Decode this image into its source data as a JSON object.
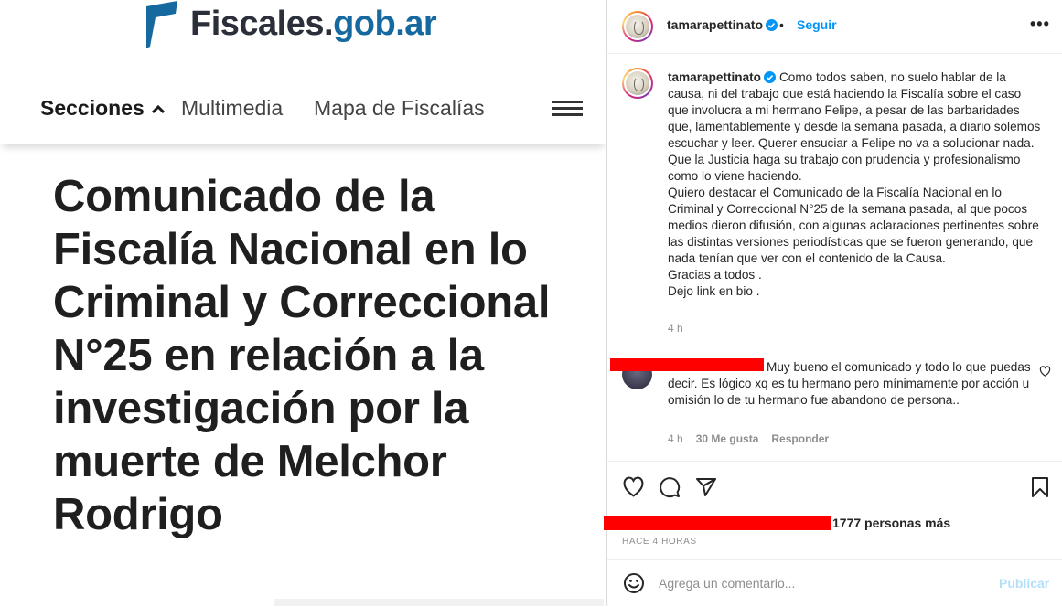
{
  "site": {
    "brand_part1": "Fiscales.",
    "brand_part2": "gob.ar",
    "nav": {
      "sections": "Secciones",
      "multimedia": "Multimedia",
      "mapa": "Mapa de Fiscalías"
    },
    "headline": "Comunicado de la Fiscalía Nacional en lo Criminal y Correccional N°25 en relación a la investigación por la muerte de Melchor Rodrigo"
  },
  "instagram": {
    "username": "tamarapettinato",
    "separator": "•",
    "follow_label": "Seguir",
    "more_label": "•••",
    "caption_text": "Como todos saben, no suelo hablar de la causa, ni del trabajo que está haciendo la Fiscalía sobre el caso que involucra a mi hermano Felipe, a pesar de las barbaridades que, lamentablemente y desde la semana pasada, a diario solemos escuchar y leer. Querer ensuciar a Felipe no va a solucionar nada. Que la Justicia haga su trabajo con prudencia y profesionalismo como lo viene haciendo.\nQuiero destacar el Comunicado de la Fiscalía Nacional en lo Criminal y Correccional N°25 de la semana pasada, al que pocos medios dieron difusión, con algunas aclaraciones pertinentes sobre las distintas versiones periodísticas que se fueron generando, que nada tenían que ver con el contenido de la Causa.\nGracias a todos .\nDejo link en bio .",
    "caption_time": "4 h",
    "comment": {
      "text": "Muy bueno el comunicado y todo lo que puedas decir. Es lógico xq es tu hermano pero mínimamente por acción u omisión lo de tu hermano fue abandono de persona..",
      "time": "4 h",
      "likes": "30 Me gusta",
      "reply": "Responder"
    },
    "likes_text": "1777 personas más",
    "time_ago": "HACE 4 HORAS",
    "comment_placeholder": "Agrega un comentario...",
    "post_label": "Publicar"
  },
  "colors": {
    "brand_dark": "#2a2f3a",
    "brand_blue": "#16699f",
    "ig_blue": "#0095f6",
    "redaction": "#ff0000"
  },
  "icons": [
    "fiscales-logo-icon",
    "chevron-up-icon",
    "hamburger-menu-icon",
    "verified-badge-icon",
    "heart-icon",
    "comment-icon",
    "share-icon",
    "bookmark-icon",
    "emoji-icon"
  ]
}
